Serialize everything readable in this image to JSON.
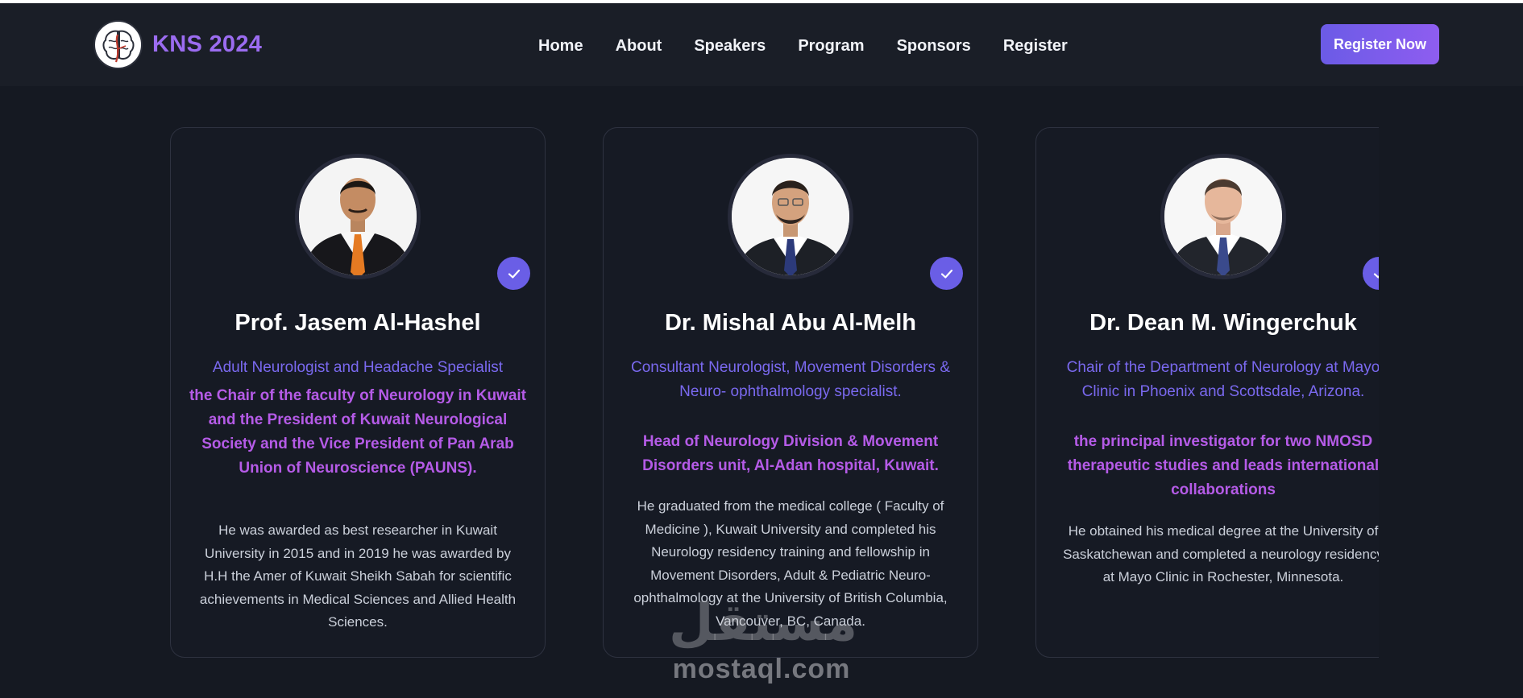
{
  "brand": {
    "name": "KNS 2024",
    "logo_icon": "brain-icon"
  },
  "nav": {
    "links": [
      "Home",
      "About",
      "Speakers",
      "Program",
      "Sponsors",
      "Register"
    ],
    "cta_label": "Register Now"
  },
  "speakers": [
    {
      "name": "Prof. Jasem Al-Hashel",
      "role": "Adult Neurologist and Headache Specialist",
      "highlight": "the Chair of the faculty of Neurology in Kuwait and the President of Kuwait Neurological Society and the Vice President of Pan Arab Union of Neuroscience (PAUNS).",
      "bio": "He was awarded as best researcher in Kuwait University in 2015 and in 2019 he was awarded by H.H the Amer of Kuwait Sheikh Sabah for scientific achievements in Medical Sciences and Allied Health Sciences."
    },
    {
      "name": "Dr. Mishal Abu Al-Melh",
      "role": "Consultant Neurologist, Movement Disorders & Neuro- ophthalmology specialist.",
      "highlight": "Head of Neurology Division & Movement Disorders unit, Al-Adan hospital, Kuwait.",
      "bio": "He graduated from the medical college ( Faculty of Medicine ), Kuwait University and completed his Neurology residency training and fellowship in Movement Disorders, Adult & Pediatric Neuro-ophthalmology at the University of British Columbia, Vancouver, BC, Canada."
    },
    {
      "name": "Dr. Dean M. Wingerchuk",
      "role": "Chair of the Department of Neurology at Mayo Clinic in Phoenix and Scottsdale, Arizona.",
      "highlight": "the principal investigator for two NMOSD therapeutic studies and leads international collaborations",
      "bio": "He obtained his medical degree at the University of Saskatchewan and completed a neurology residency at Mayo Clinic in Rochester, Minnesota."
    }
  ],
  "watermark": {
    "arabic": "مستقل",
    "latin": "mostaql.com"
  },
  "colors": {
    "background": "#151922",
    "navbar": "#1a1e27",
    "brand": "#9b6cf0",
    "role_text": "#7a69ef",
    "highlight_text": "#b55be7",
    "badge": "#6a5ee6",
    "cta_start": "#6b5be6",
    "cta_end": "#8e5df0"
  }
}
